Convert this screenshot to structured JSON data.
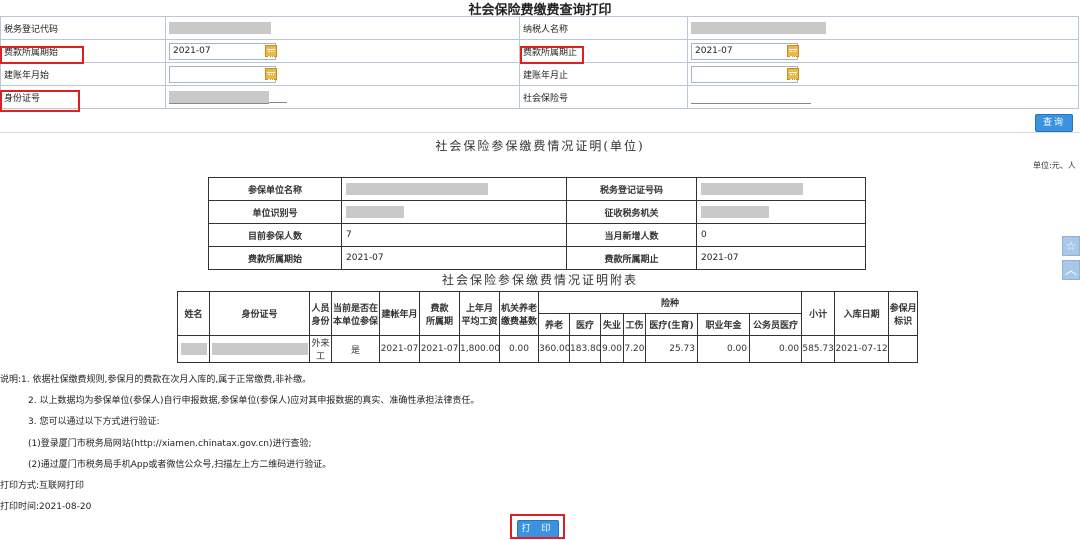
{
  "page_title": "社会保险费缴费查询打印",
  "form": {
    "tax_reg_code_label": "税务登记代码",
    "taxpayer_name_label": "纳税人名称",
    "period_start_label": "费款所属期始",
    "period_start_value": "2021-07",
    "period_end_label": "费款所属期止",
    "period_end_value": "2021-07",
    "account_start_label": "建账年月始",
    "account_start_value": "",
    "account_end_label": "建账年月止",
    "account_end_value": "",
    "id_number_label": "身份证号",
    "social_security_no_label": "社会保险号",
    "query_button": "查询"
  },
  "certificate": {
    "title": "社会保险参保缴费情况证明(单位)",
    "unit_note": "单位:元、人",
    "labels": {
      "unit_name": "参保单位名称",
      "tax_reg_no": "税务登记证号码",
      "unit_id": "单位识别号",
      "tax_authority": "征收税务机关",
      "current_insured": "目前参保人数",
      "new_this_month": "当月新增人数",
      "period_start": "费款所属期始",
      "period_end": "费款所属期止"
    },
    "values": {
      "current_insured": "7",
      "new_this_month": "0",
      "period_start": "2021-07",
      "period_end": "2021-07"
    }
  },
  "detail": {
    "title": "社会保险参保缴费情况证明附表",
    "headers": {
      "name": "姓名",
      "id_number": "身份证号",
      "person_type_1": "人员",
      "person_type_2": "身份",
      "current_1": "当前是否在",
      "current_2": "本单位参保",
      "account_month": "建帐年月",
      "period_1": "费款",
      "period_2": "所属期",
      "last_year_1": "上年月",
      "last_year_2": "平均工资",
      "agency_1": "机关养老",
      "agency_2": "缴费基数",
      "insurance_types": "险种",
      "pension": "养老",
      "medical": "医疗",
      "unemployment": "失业",
      "injury": "工伤",
      "maternity": "医疗(生育)",
      "occupational": "职业年金",
      "civil_medical": "公务员医疗",
      "subtotal": "小计",
      "entry_date": "入库日期",
      "insured_month_1": "参保月",
      "insured_month_2": "标识"
    },
    "row": {
      "person_type_1": "外来",
      "person_type_2": "工",
      "current": "是",
      "account_month": "2021-07",
      "period": "2021-07",
      "last_year_avg": "1,800.00",
      "agency_base": "0.00",
      "pension": "360.00",
      "medical": "183.80",
      "unemployment": "9.00",
      "injury": "7.20",
      "maternity": "25.73",
      "occupational": "0.00",
      "civil_medical": "0.00",
      "subtotal": "585.73",
      "entry_date": "2021-07-12",
      "insured_month": ""
    }
  },
  "notes": {
    "n1": "说明:1. 依据社保缴费规则,参保月的费款在次月入库的,属于正常缴费,非补缴。",
    "n2": "2. 以上数据均为参保单位(参保人)自行申报数据,参保单位(参保人)应对其申报数据的真实、准确性承担法律责任。",
    "n3": "3. 您可以通过以下方式进行验证:",
    "n4": "(1)登录厦门市税务局网站(http://xiamen.chinatax.gov.cn)进行查验;",
    "n5": "(2)通过厦门市税务局手机App或者微信公众号,扫描左上方二维码进行验证。",
    "print_method": "打印方式:互联网打印",
    "print_time": "打印时间:2021-08-20"
  },
  "print_button": "打 印",
  "colors": {
    "button_blue": "#3b92e0",
    "highlight_red": "#e02020",
    "calendar_icon": "#e9b94c"
  }
}
